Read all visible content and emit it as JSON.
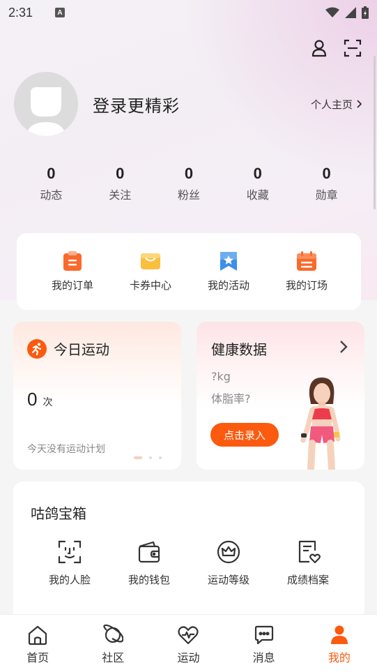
{
  "status_bar": {
    "time": "2:31",
    "indicator": "A"
  },
  "header": {
    "icons": [
      "user-icon",
      "scan-icon"
    ]
  },
  "profile": {
    "login_text": "登录更精彩",
    "homepage_label": "个人主页"
  },
  "stats": [
    {
      "value": "0",
      "label": "动态"
    },
    {
      "value": "0",
      "label": "关注"
    },
    {
      "value": "0",
      "label": "粉丝"
    },
    {
      "value": "0",
      "label": "收藏"
    },
    {
      "value": "0",
      "label": "勋章"
    }
  ],
  "quick_actions": [
    {
      "label": "我的订单",
      "icon": "order-icon"
    },
    {
      "label": "卡券中心",
      "icon": "coupon-icon"
    },
    {
      "label": "我的活动",
      "icon": "activity-icon"
    },
    {
      "label": "我的订场",
      "icon": "venue-booking-icon"
    }
  ],
  "today_sport": {
    "title": "今日运动",
    "count": "0",
    "unit": "次",
    "hint": "今天没有运动计划"
  },
  "health": {
    "title": "健康数据",
    "weight": "?kg",
    "body_fat": "体脂率?",
    "button": "点击录入"
  },
  "treasure_box": {
    "title": "咕鸽宝箱",
    "items": [
      {
        "label": "我的人脸",
        "icon": "face-scan-icon"
      },
      {
        "label": "我的钱包",
        "icon": "wallet-icon"
      },
      {
        "label": "运动等级",
        "icon": "crown-icon"
      },
      {
        "label": "成绩档案",
        "icon": "record-file-icon"
      }
    ]
  },
  "bottom_nav": [
    {
      "label": "首页",
      "icon": "home-icon"
    },
    {
      "label": "社区",
      "icon": "planet-icon"
    },
    {
      "label": "运动",
      "icon": "heartbeat-icon"
    },
    {
      "label": "消息",
      "icon": "message-icon"
    },
    {
      "label": "我的",
      "icon": "profile-icon",
      "active": true
    }
  ],
  "colors": {
    "accent": "#fb5a0f",
    "order_icon": "#fa6a2c",
    "coupon_icon": "#fbbf3f",
    "activity_icon": "#3d8fe8"
  }
}
